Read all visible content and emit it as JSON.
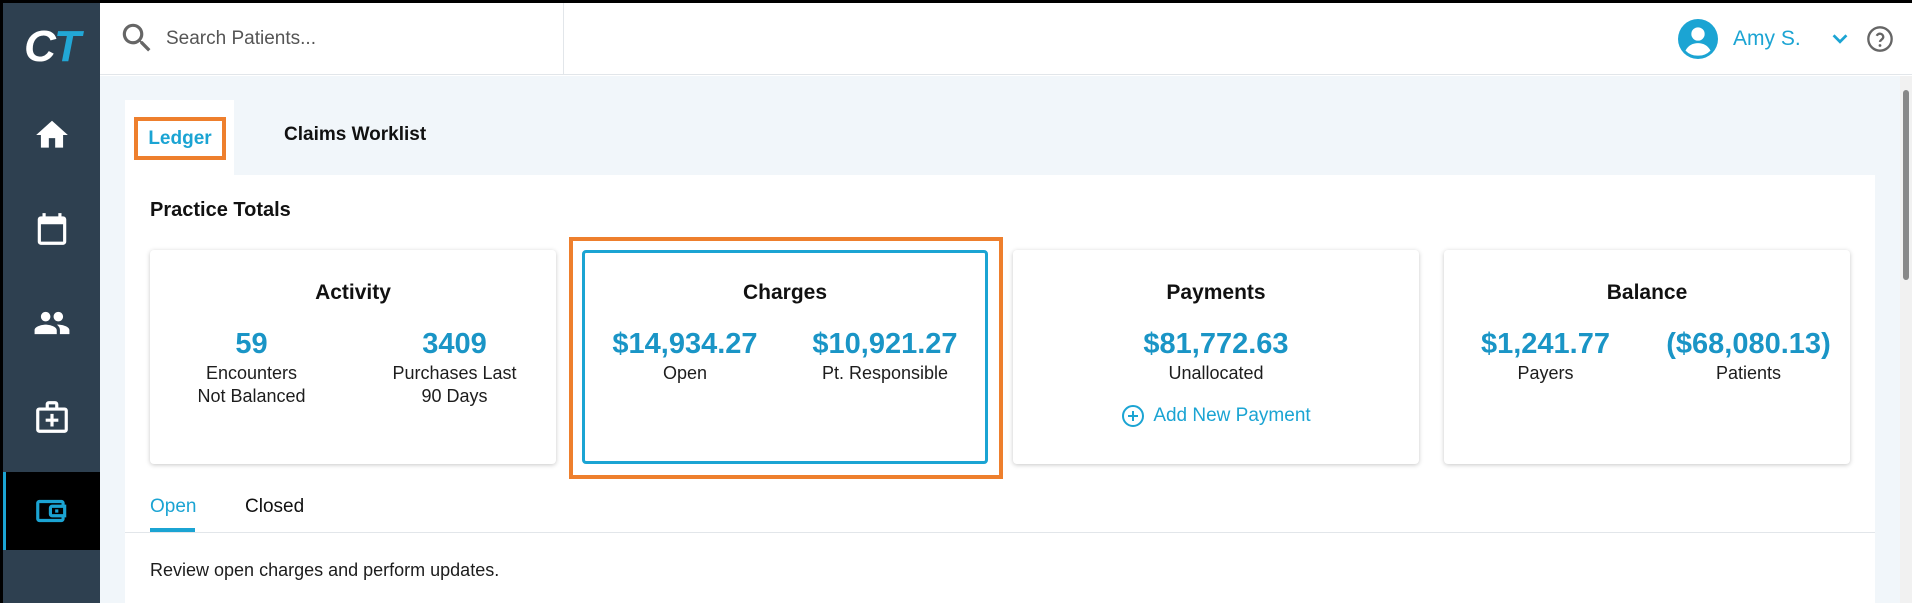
{
  "app": {
    "logo_left": "C",
    "logo_right": "T"
  },
  "sidebar": {
    "items": [
      {
        "name": "home",
        "icon": "home-icon",
        "active": false
      },
      {
        "name": "calendar",
        "icon": "calendar-icon",
        "active": false
      },
      {
        "name": "patients",
        "icon": "people-icon",
        "active": false
      },
      {
        "name": "medical",
        "icon": "medical-kit-icon",
        "active": false
      },
      {
        "name": "billing",
        "icon": "wallet-icon",
        "active": true
      }
    ]
  },
  "header": {
    "search_placeholder": "Search Patients...",
    "user_name": "Amy S.",
    "help_icon": "help-icon"
  },
  "tabs": [
    {
      "label": "Ledger",
      "active": true
    },
    {
      "label": "Claims Worklist",
      "active": false
    }
  ],
  "section_title": "Practice Totals",
  "cards": {
    "activity": {
      "title": "Activity",
      "stats": [
        {
          "value": "59",
          "label_line1": "Encounters",
          "label_line2": "Not Balanced"
        },
        {
          "value": "3409",
          "label_line1": "Purchases Last",
          "label_line2": "90 Days"
        }
      ]
    },
    "charges": {
      "title": "Charges",
      "stats": [
        {
          "value": "$14,934.27",
          "label": "Open"
        },
        {
          "value": "$10,921.27",
          "label": "Pt. Responsible"
        }
      ]
    },
    "payments": {
      "title": "Payments",
      "stats": [
        {
          "value": "$81,772.63",
          "label": "Unallocated"
        }
      ],
      "add_label": "Add New Payment"
    },
    "balance": {
      "title": "Balance",
      "stats": [
        {
          "value": "$1,241.77",
          "label": "Payers"
        },
        {
          "value": "($68,080.13)",
          "label": "Patients"
        }
      ]
    }
  },
  "subtabs": [
    {
      "label": "Open",
      "active": true
    },
    {
      "label": "Closed",
      "active": false
    }
  ],
  "description": "Review open charges and perform updates.",
  "colors": {
    "accent": "#1ba4d3",
    "value_blue": "#1a95c6",
    "highlight_orange": "#ee7f2d",
    "sidebar_bg": "#2e4050"
  }
}
